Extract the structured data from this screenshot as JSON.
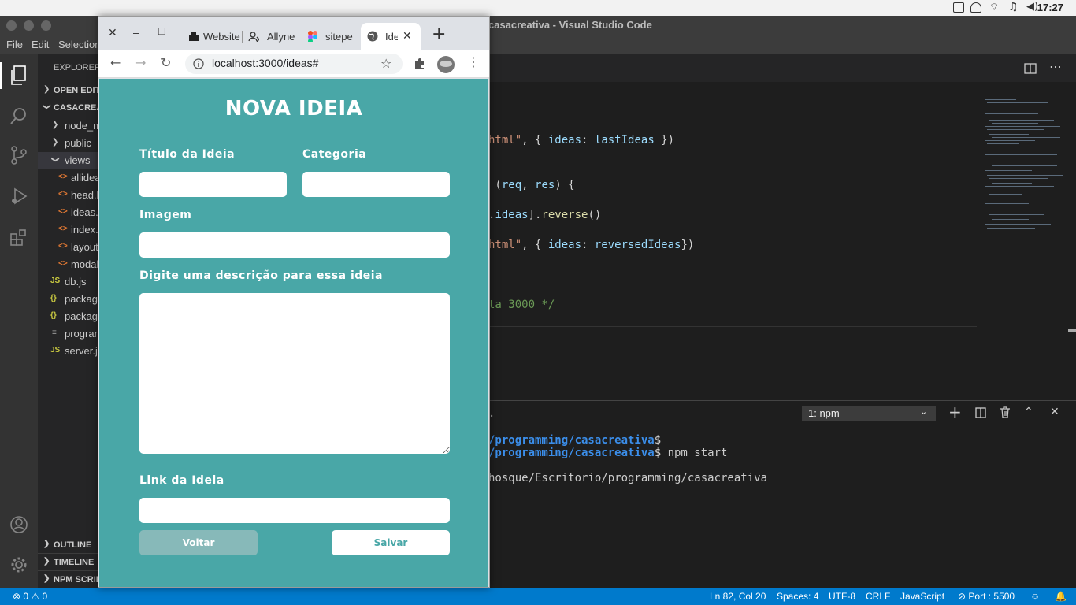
{
  "os": {
    "clock": "17:27"
  },
  "vscode": {
    "window_title": "casacreativa - Visual Studio Code",
    "menu": [
      "File",
      "Edit",
      "Selection"
    ],
    "explorer": {
      "header": "EXPLORER",
      "open_editors": "OPEN EDITORS",
      "project": "CASACREATIVA",
      "items": [
        {
          "label": "node_modules",
          "type": "folder",
          "expanded": false
        },
        {
          "label": "public",
          "type": "folder",
          "expanded": false
        },
        {
          "label": "views",
          "type": "folder",
          "expanded": true
        },
        {
          "label": "allideas.html",
          "type": "html"
        },
        {
          "label": "head.html",
          "type": "html"
        },
        {
          "label": "ideas.html",
          "type": "html"
        },
        {
          "label": "index.html",
          "type": "html"
        },
        {
          "label": "layout.html",
          "type": "html"
        },
        {
          "label": "modal.html",
          "type": "html"
        },
        {
          "label": "db.js",
          "type": "js"
        },
        {
          "label": "package.json",
          "type": "json"
        },
        {
          "label": "package-lock.json",
          "type": "json"
        },
        {
          "label": "programming",
          "type": "text"
        },
        {
          "label": "server.js",
          "type": "js"
        }
      ],
      "sections": [
        "OUTLINE",
        "TIMELINE",
        "NPM SCRIPTS"
      ]
    },
    "code_lines": [
      {
        "parts": [
          [
            "s",
            "html\""
          ],
          [
            "d",
            ", { "
          ],
          [
            "v",
            "ideas"
          ],
          [
            "d",
            ": "
          ],
          [
            "v",
            "lastIdeas"
          ],
          [
            "d",
            " })"
          ]
        ]
      },
      {
        "parts": [
          [
            "d",
            " ("
          ],
          [
            "v",
            "req"
          ],
          [
            "d",
            ", "
          ],
          [
            "v",
            "res"
          ],
          [
            "d",
            ") {"
          ]
        ]
      },
      {
        "parts": [
          [
            "d",
            "."
          ],
          [
            "v",
            "ideas"
          ],
          [
            "d",
            "]."
          ],
          [
            "f",
            "reverse"
          ],
          [
            "d",
            "()"
          ]
        ]
      },
      {
        "parts": [
          [
            "s",
            "html\""
          ],
          [
            "d",
            ", { "
          ],
          [
            "v",
            "ideas"
          ],
          [
            "d",
            ": "
          ],
          [
            "v",
            "reversedIdeas"
          ],
          [
            "d",
            "})"
          ]
        ]
      },
      {
        "parts": [
          [
            "c",
            "ta 3000 */"
          ]
        ]
      }
    ],
    "terminal": {
      "selector": "1: npm",
      "lines": [
        {
          "path": "/programming/casacreativa",
          "rest": "$"
        },
        {
          "path": "/programming/casacreativa",
          "rest": "$ npm start"
        },
        {
          "path": "",
          "rest": "hosque/Escritorio/programming/casacreativa"
        }
      ]
    },
    "status": {
      "problems": "⊗ 0 ⚠ 0",
      "position": "Ln 82, Col 20",
      "spaces": "Spaces: 4",
      "encoding": "UTF-8",
      "eol": "CRLF",
      "language": "JavaScript",
      "port": "⊘ Port : 5500"
    }
  },
  "browser": {
    "tabs": [
      {
        "label": "Website",
        "active": false
      },
      {
        "label": "Allyne",
        "active": false
      },
      {
        "label": "sitepe",
        "active": false
      },
      {
        "label": "Ideas",
        "active": true
      }
    ],
    "url": "localhost:3000/ideas#"
  },
  "form": {
    "title": "NOVA IDEIA",
    "title_label": "Título da Ideia",
    "category_label": "Categoria",
    "image_label": "Imagem",
    "description_label": "Digite uma descrição para essa ideia",
    "link_label": "Link da Ideia",
    "back_button": "Voltar",
    "save_button": "Salvar"
  }
}
